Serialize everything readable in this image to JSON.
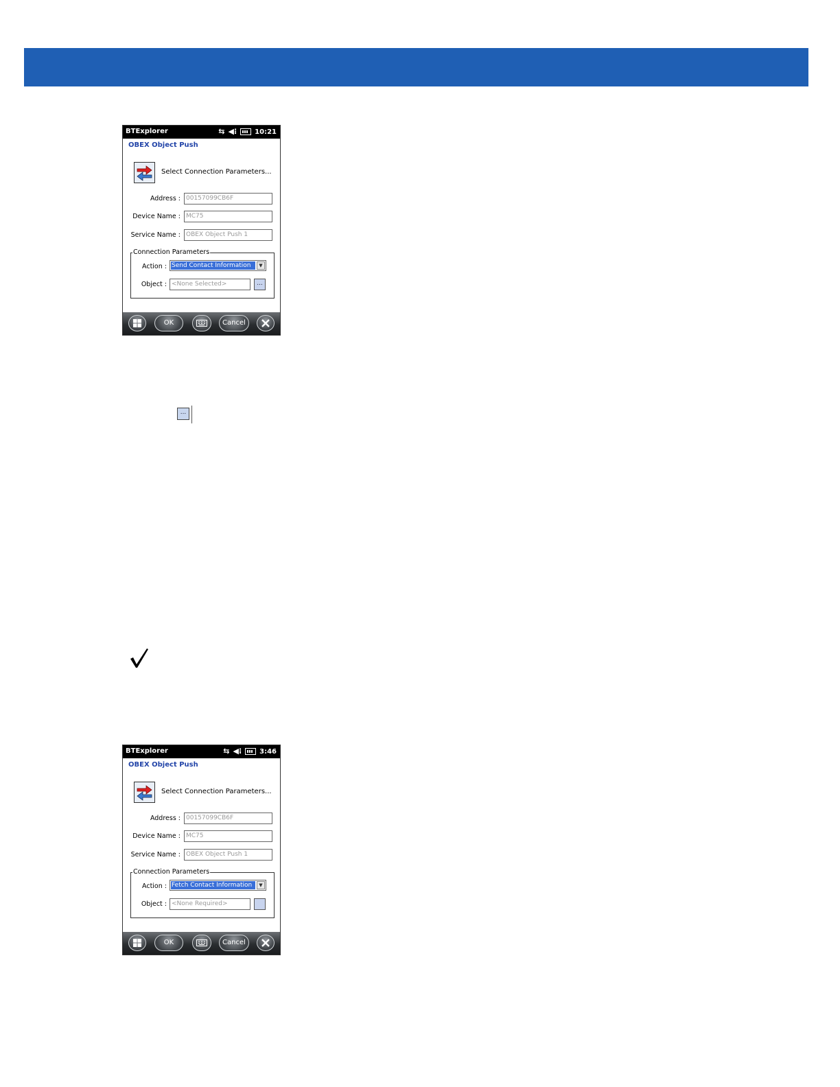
{
  "screens": [
    {
      "status": {
        "app": "BTExplorer",
        "time": "10:21"
      },
      "subtitle": "OBEX Object Push",
      "prompt": "Select Connection Parameters...",
      "fields": {
        "address_label": "Address :",
        "address_value": "00157099CB6F",
        "device_label": "Device Name :",
        "device_value": "MC75",
        "service_label": "Service Name :",
        "service_value": "OBEX Object Push 1"
      },
      "group_title": "Connection Parameters",
      "action_label": "Action :",
      "action_value": "Send Contact Information",
      "object_label": "Object :",
      "object_value": "<None Selected>",
      "browse_label": "...",
      "taskbar": {
        "ok": "OK",
        "cancel": "Cancel"
      }
    },
    {
      "status": {
        "app": "BTExplorer",
        "time": "3:46"
      },
      "subtitle": "OBEX Object Push",
      "prompt": "Select Connection Parameters...",
      "fields": {
        "address_label": "Address :",
        "address_value": "00157099CB6F",
        "device_label": "Device Name :",
        "device_value": "MC75",
        "service_label": "Service Name :",
        "service_value": "OBEX Object Push 1"
      },
      "group_title": "Connection Parameters",
      "action_label": "Action :",
      "action_value": "Fetch Contact Information",
      "object_label": "Object :",
      "object_value": "<None Required>",
      "browse_label": "",
      "taskbar": {
        "ok": "OK",
        "cancel": "Cancel"
      }
    }
  ],
  "inline_browse_label": "...",
  "colors": {
    "header_band": "#1f5fb4",
    "title_blue": "#2244a8",
    "selection": "#3a6fd8"
  },
  "icons": [
    "connection-icon",
    "windows-start-icon",
    "keyboard-icon",
    "close-icon",
    "note-checkmark-icon"
  ]
}
